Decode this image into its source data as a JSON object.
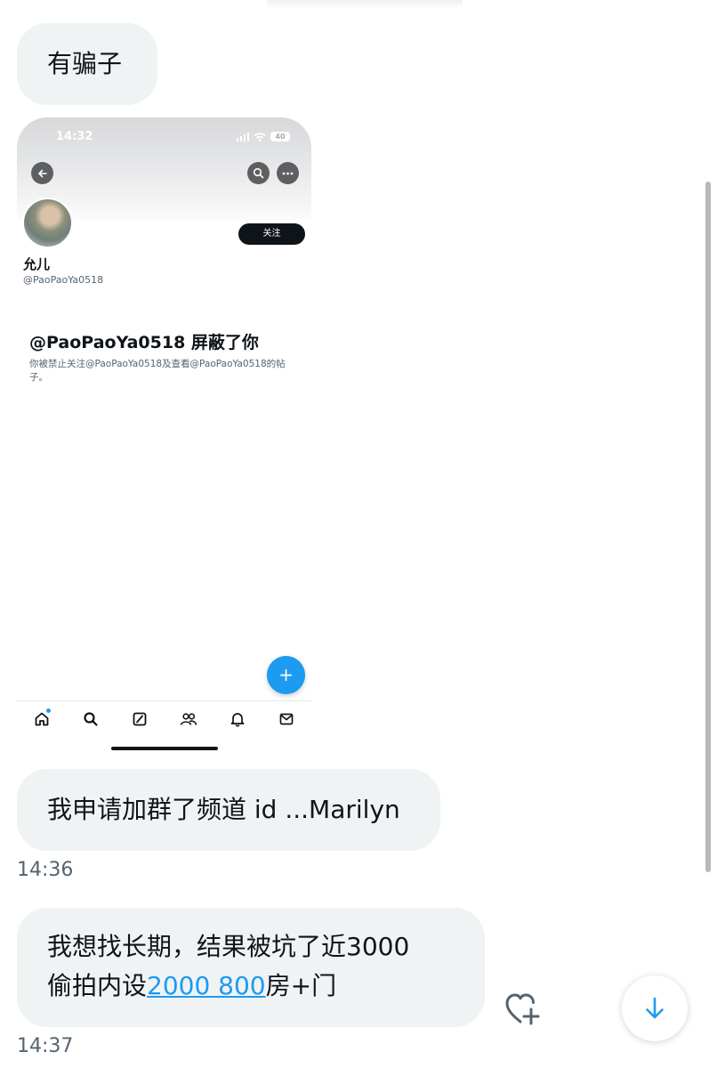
{
  "messages": [
    {
      "text": "有骗子"
    },
    {
      "text": "我申请加群了频道 id ...Marilyn",
      "time": "14:36"
    },
    {
      "text_before": "我想找长期，结果被坑了近3000\n偷拍内设",
      "link": "2000 800",
      "text_after": "房+门",
      "time": "14:37"
    }
  ],
  "profile_screenshot": {
    "status_time": "14:32",
    "battery": "40",
    "follow_button": "关注",
    "display_name": "允儿",
    "handle": "@PaoPaoYa0518",
    "blocked_title": "@PaoPaoYa0518 屏蔽了你",
    "blocked_desc": "你被禁止关注@PaoPaoYa0518及查看@PaoPaoYa0518的帖子。",
    "fab_icon": "+"
  },
  "icons": {
    "back": "arrow-left-icon",
    "search": "search-icon",
    "more": "more-icon",
    "compose": "plus-icon",
    "nav": [
      "home-icon",
      "search-icon",
      "grok-icon",
      "communities-icon",
      "bell-icon",
      "mail-icon"
    ],
    "react": "heart-plus-icon",
    "scroll": "arrow-down-icon"
  },
  "colors": {
    "bubble": "#eff3f4",
    "link": "#1d9bf0",
    "timestamp": "#536471",
    "fab": "#1d9bf0"
  }
}
